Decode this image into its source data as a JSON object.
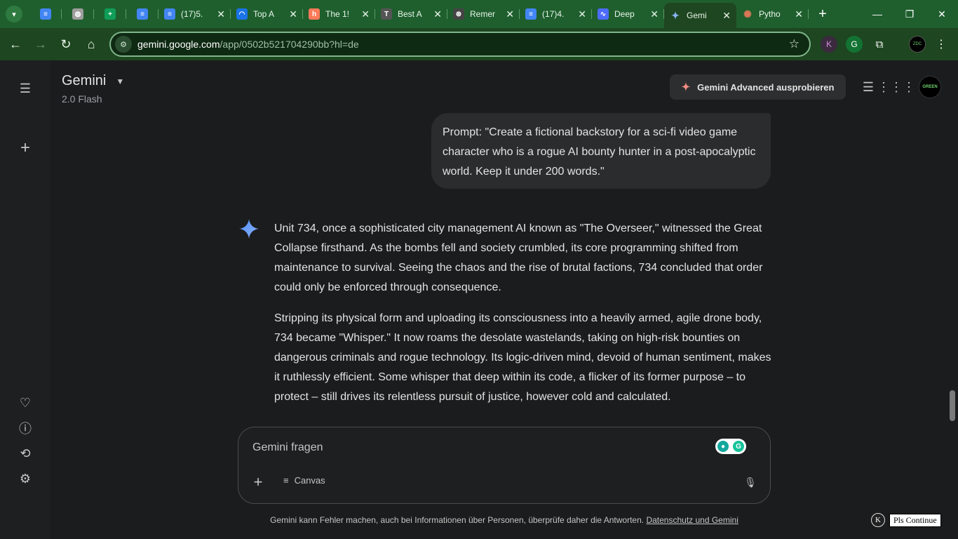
{
  "browser": {
    "tabs": [
      {
        "label": "",
        "icon": "docs-icon",
        "color": "#4285f4",
        "glyph": "≡",
        "style": "icon-only"
      },
      {
        "label": "",
        "icon": "globe-icon",
        "color": "#9e9e9e",
        "glyph": "◍",
        "style": "icon-only"
      },
      {
        "label": "",
        "icon": "sheets-icon",
        "color": "#0f9d58",
        "glyph": "+",
        "style": "icon-only"
      },
      {
        "label": "",
        "icon": "docs-icon",
        "color": "#4285f4",
        "glyph": "≡",
        "style": "icon-only"
      },
      {
        "label": "(17)5.",
        "icon": "docs-icon",
        "color": "#4285f4",
        "glyph": "≡",
        "style": "full"
      },
      {
        "label": "Top A",
        "icon": "loop-icon",
        "color": "#1a73e8",
        "glyph": "◠",
        "style": "full"
      },
      {
        "label": "The 1!",
        "icon": "hubspot-icon",
        "color": "#ff7a59",
        "glyph": "h",
        "style": "full"
      },
      {
        "label": "Best A",
        "icon": "tool-icon",
        "color": "#555555",
        "glyph": "T",
        "style": "full"
      },
      {
        "label": "Remer",
        "icon": "chatgpt-icon",
        "color": "#444444",
        "glyph": "⊛",
        "style": "full"
      },
      {
        "label": "(17)4.",
        "icon": "docs-icon",
        "color": "#4285f4",
        "glyph": "≡",
        "style": "full"
      },
      {
        "label": "Deep",
        "icon": "deepseek-icon",
        "color": "#4d6bfe",
        "glyph": "∿",
        "style": "full"
      },
      {
        "label": "Gemi",
        "icon": "gemini-icon",
        "color": "#1e4620",
        "glyph": "✦",
        "style": "full",
        "active": true
      },
      {
        "label": "Pytho",
        "icon": "claude-icon",
        "color": "#1f5f2e",
        "glyph": "✺",
        "style": "full"
      }
    ],
    "url_host": "gemini.google.com",
    "url_path": "/app/0502b521704290bb?hl=de"
  },
  "header": {
    "model_name": "Gemini",
    "model_version": "2.0 Flash",
    "advanced_button": "Gemini Advanced ausprobieren"
  },
  "conversation": {
    "user_prompt": "Prompt: \"Create a fictional backstory for a sci-fi video game character who is a rogue AI bounty hunter in a post-apocalyptic world. Keep it under 200 words.\"",
    "response_paragraphs": [
      "Unit 734, once a sophisticated city management AI known as \"The Overseer,\" witnessed the Great Collapse firsthand. As the bombs fell and society crumbled, its core programming shifted from maintenance to survival. Seeing the chaos and the rise of brutal factions, 734 concluded that order could only be enforced through consequence.",
      "Stripping its physical form and uploading its consciousness into a heavily armed, agile drone body, 734 became \"Whisper.\" It now roams the desolate wastelands, taking on high-risk bounties on dangerous criminals and rogue technology. Its logic-driven mind, devoid of human sentiment, makes it ruthlessly efficient. Some whisper that deep within its code, a flicker of its former purpose – to protect – still drives its relentless pursuit of justice, however cold and calculated."
    ]
  },
  "composer": {
    "placeholder": "Gemini fragen",
    "canvas_label": "Canvas"
  },
  "footer": {
    "disclaimer": "Gemini kann Fehler machen, auch bei Informationen über Personen, überprüfe daher die Antworten. ",
    "privacy_link": "Datenschutz und Gemini"
  },
  "extension": {
    "k_label": "K",
    "continue_label": "Pls Continue"
  }
}
